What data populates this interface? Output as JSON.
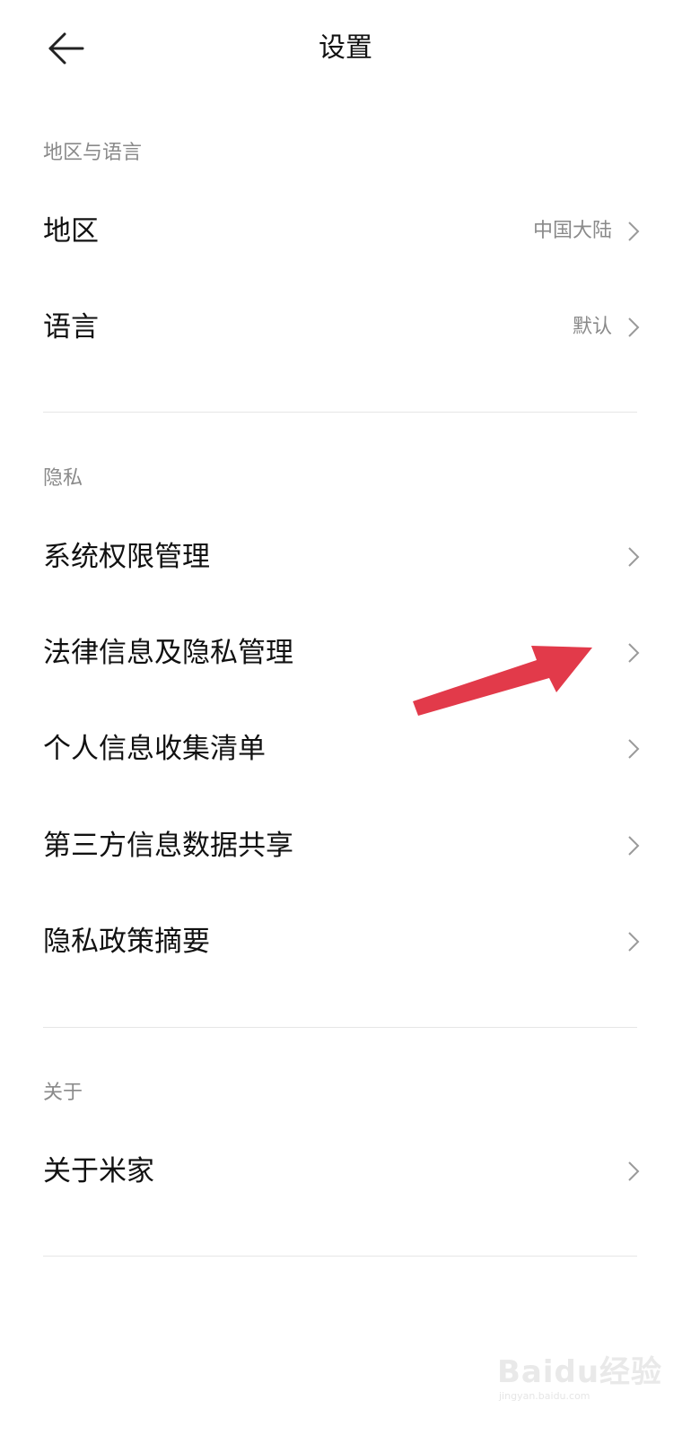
{
  "header": {
    "title": "设置",
    "back_icon": "arrow-left-icon"
  },
  "sections": {
    "region_language": {
      "label": "地区与语言",
      "items": [
        {
          "label": "地区",
          "value": "中国大陆"
        },
        {
          "label": "语言",
          "value": "默认"
        }
      ]
    },
    "privacy": {
      "label": "隐私",
      "items": [
        {
          "label": "系统权限管理"
        },
        {
          "label": "法律信息及隐私管理"
        },
        {
          "label": "个人信息收集清单"
        },
        {
          "label": "第三方信息数据共享"
        },
        {
          "label": "隐私政策摘要"
        }
      ]
    },
    "about": {
      "label": "关于",
      "items": [
        {
          "label": "关于米家"
        }
      ]
    }
  },
  "annotation": {
    "arrow_color": "#e23a4a",
    "icon": "red-arrow-icon"
  },
  "watermark": {
    "logo": "Baidu经验",
    "url": "jingyan.baidu.com"
  },
  "colors": {
    "background": "#ffffff",
    "primary_text": "#111111",
    "secondary_text": "#8a8a8a",
    "divider": "#e6e6e6"
  }
}
